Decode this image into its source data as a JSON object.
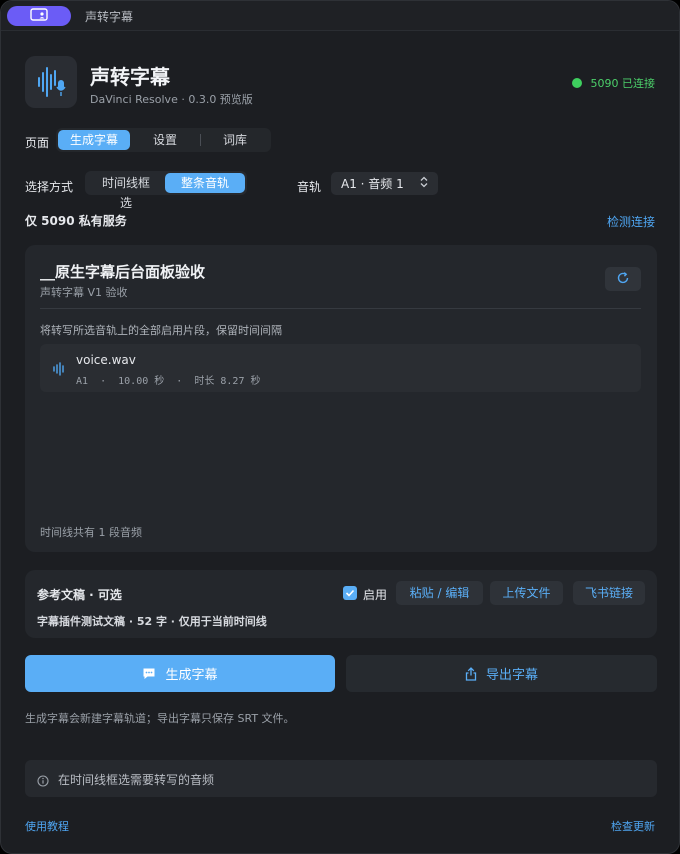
{
  "window": {
    "title": "声转字幕"
  },
  "header": {
    "app_name": "声转字幕",
    "subtitle": "DaVinci Resolve · 0.3.0 预览版",
    "status": "5090 已连接",
    "status_color": "#3ecf5e"
  },
  "page_nav": {
    "label": "页面",
    "tabs": [
      {
        "label": "生成字幕",
        "active": true
      },
      {
        "label": "设置",
        "active": false
      },
      {
        "label": "词库",
        "active": false
      }
    ]
  },
  "selection": {
    "label": "选择方式",
    "options": [
      {
        "label": "时间线框选",
        "active": false
      },
      {
        "label": "整条音轨",
        "active": true
      }
    ],
    "track_label": "音轨",
    "track_value": "A1 · 音频 1"
  },
  "service": {
    "label": "仅 5090 私有服务",
    "check_link": "检测连接"
  },
  "timeline_card": {
    "title": "__原生字幕后台面板验收",
    "subtitle": "声转字幕 V1 验收",
    "description": "将转写所选音轨上的全部启用片段，保留时间间隔",
    "clips": [
      {
        "name": "voice.wav",
        "meta": "A1  ·  10.00 秒  ·  时长 8.27 秒"
      }
    ],
    "footer": "时间线共有 1 段音频"
  },
  "reference": {
    "title": "参考文稿 · 可选",
    "enable_label": "启用",
    "enabled": true,
    "buttons": [
      "粘贴 / 编辑",
      "上传文件",
      "飞书链接"
    ],
    "meta": "字幕插件测试文稿 · 52 字 · 仅用于当前时间线"
  },
  "actions": {
    "generate": "生成字幕",
    "export": "导出字幕",
    "hint": "生成字幕会新建字幕轨道；导出字幕只保存 SRT 文件。"
  },
  "info": {
    "text": "在时间线框选需要转写的音频"
  },
  "footer": {
    "tutorial": "使用教程",
    "update": "检查更新"
  },
  "colors": {
    "accent": "#5aaef6",
    "background": "#1c1e22",
    "card": "#24272c",
    "titlebar_pill": "#6b5cf6"
  },
  "icons": {
    "app": "waveform-microphone-icon",
    "refresh": "refresh-icon",
    "clip": "waveform-icon",
    "generate": "subtitle-icon",
    "export": "share-icon",
    "info": "info-icon",
    "select": "chevron-updown-icon",
    "titlebar": "panel-user-icon"
  }
}
